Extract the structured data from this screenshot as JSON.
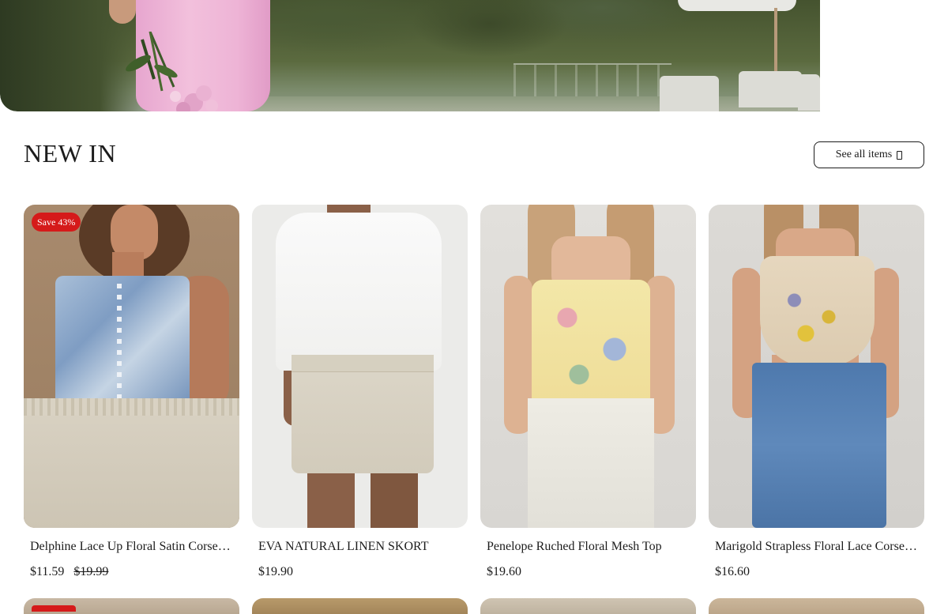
{
  "hero": {
    "image_icon": "lifestyle-photo"
  },
  "section": {
    "title": "NEW IN",
    "see_all_label": "See all items",
    "see_all_icon": "arrow-right-icon"
  },
  "products": [
    {
      "title": "Delphine Lace Up Floral Satin Corse…",
      "price": "$11.59",
      "compare_price": "$19.99",
      "badge": "Save 43%"
    },
    {
      "title": "EVA NATURAL LINEN SKORT",
      "price": "$19.90"
    },
    {
      "title": "Penelope Ruched Floral Mesh Top",
      "price": "$19.60"
    },
    {
      "title": "Marigold Strapless Floral Lace Corse…",
      "price": "$16.60"
    }
  ],
  "colors": {
    "badge_red": "#d51a1a",
    "text": "#1c1c1c",
    "background": "#ffffff"
  }
}
